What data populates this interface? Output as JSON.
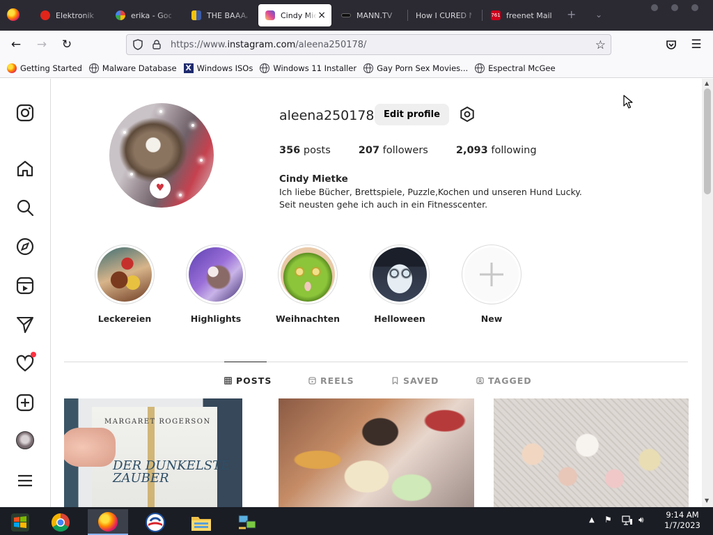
{
  "browser": {
    "tabs": [
      {
        "label": "Elektronik",
        "color": "#e1251b"
      },
      {
        "label": "erika - Goog",
        "color": "#4285f4"
      },
      {
        "label": "THE BAAAA",
        "color": "#f4c20d"
      },
      {
        "label": "Cindy Mie",
        "color": "#e1306c",
        "active": true
      },
      {
        "label": "MANN.TV",
        "color": "#222222"
      },
      {
        "label": "How I CURED M",
        "color": "#3b3b44"
      },
      {
        "label": "freenet Mail",
        "color": "#d0021b"
      }
    ],
    "new_tab_label": "+",
    "url_prefix": "https://www.",
    "url_host": "instagram.com",
    "url_path": "/aleena250178/",
    "bookmarks": [
      {
        "label": "Getting Started",
        "icon": "firefox-icon"
      },
      {
        "label": "Malware Database",
        "icon": "globe-icon"
      },
      {
        "label": "Windows ISOs",
        "icon": "x-icon"
      },
      {
        "label": "Windows 11 Installer",
        "icon": "globe-icon"
      },
      {
        "label": "Gay Porn Sex Movies...",
        "icon": "globe-icon"
      },
      {
        "label": "Espectral McGee",
        "icon": "globe-icon"
      }
    ]
  },
  "profile": {
    "username": "aleena250178",
    "edit_label": "Edit profile",
    "stats": {
      "posts_count": "356",
      "posts_label": "posts",
      "followers_count": "207",
      "followers_label": "followers",
      "following_count": "2,093",
      "following_label": "following"
    },
    "full_name": "Cindy Mietke",
    "bio_line1": "Ich liebe Bücher, Brettspiele, Puzzle,Kochen und unseren Hund Lucky.",
    "bio_line2": "Seit neusten gehe ich auch in ein Fitnesscenter."
  },
  "highlights": [
    {
      "label": "Leckereien"
    },
    {
      "label": "Highlights"
    },
    {
      "label": "Weihnachten"
    },
    {
      "label": "Helloween"
    },
    {
      "label": "New"
    }
  ],
  "profile_tabs": [
    {
      "label": "POSTS",
      "icon": "grid-icon",
      "active": true
    },
    {
      "label": "REELS",
      "icon": "reels-icon"
    },
    {
      "label": "SAVED",
      "icon": "bookmark-icon"
    },
    {
      "label": "TAGGED",
      "icon": "tag-icon"
    }
  ],
  "posts": [
    {
      "cover_author": "MARGARET ROGERSON",
      "cover_title": "DER DUNKELSTE ZAUBER"
    }
  ],
  "taskbar": {
    "clock_time": "9:14 AM",
    "clock_date": "1/7/2023"
  }
}
